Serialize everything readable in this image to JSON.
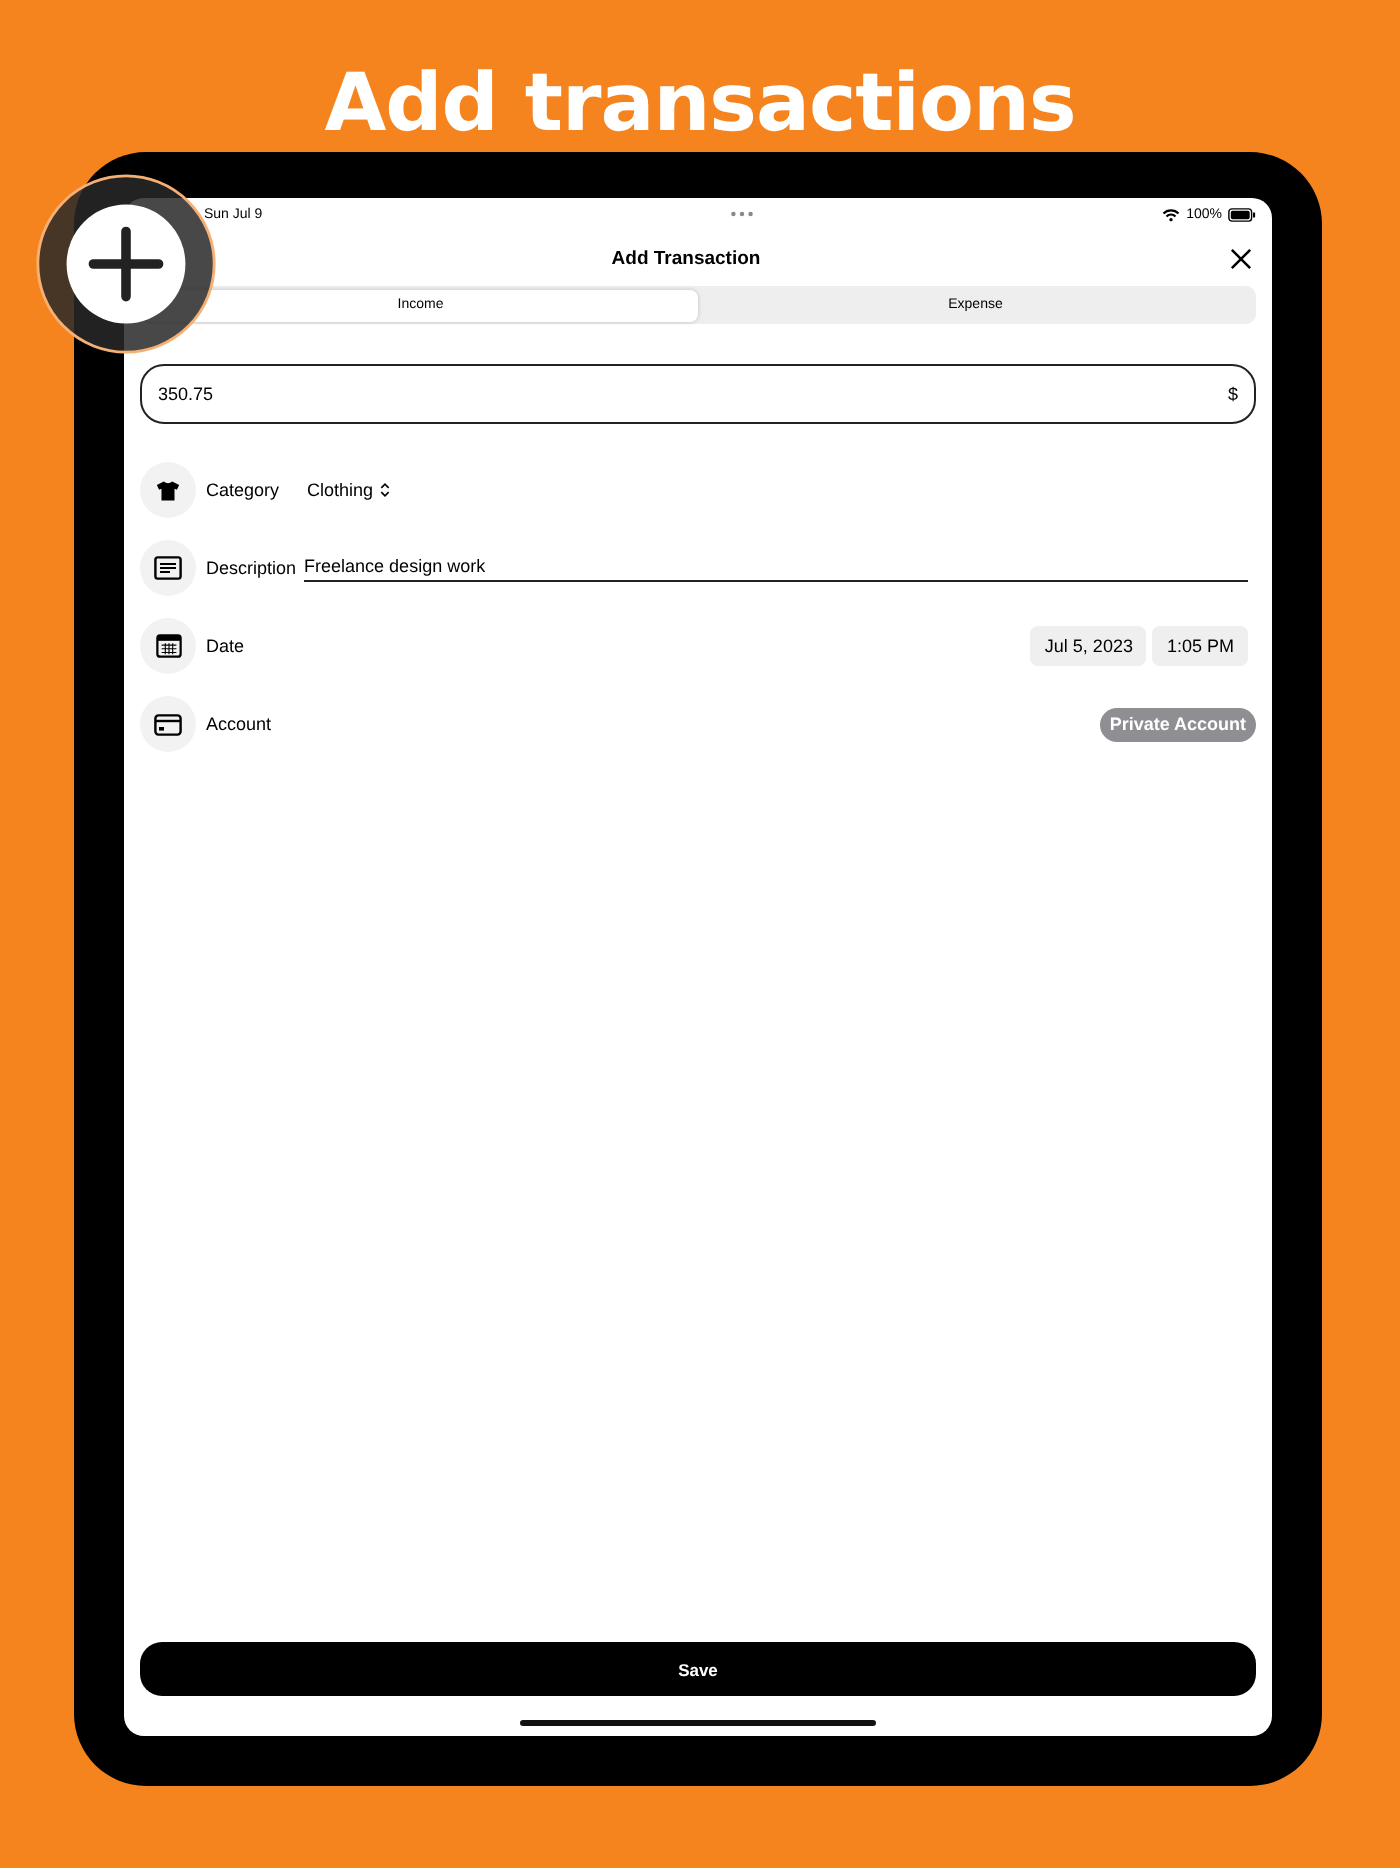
{
  "headline": "Add transactions",
  "status_bar": {
    "date": "Sun Jul 9",
    "battery_text": "100%"
  },
  "sheet": {
    "title": "Add Transaction"
  },
  "segments": [
    {
      "label": "Income",
      "selected": true
    },
    {
      "label": "Expense",
      "selected": false
    }
  ],
  "amount": {
    "value": "350.75",
    "currency": "$"
  },
  "fields": [
    {
      "kind": "picker",
      "label": "Category",
      "value": "Clothing"
    },
    {
      "kind": "text",
      "label": "Description",
      "value": "Freelance design work"
    },
    {
      "kind": "datetime",
      "label": "Date",
      "date": "Jul 5, 2023",
      "time": "1:05 PM"
    },
    {
      "kind": "badge",
      "label": "Account",
      "value": "Private Account"
    }
  ],
  "save_button": "Save"
}
